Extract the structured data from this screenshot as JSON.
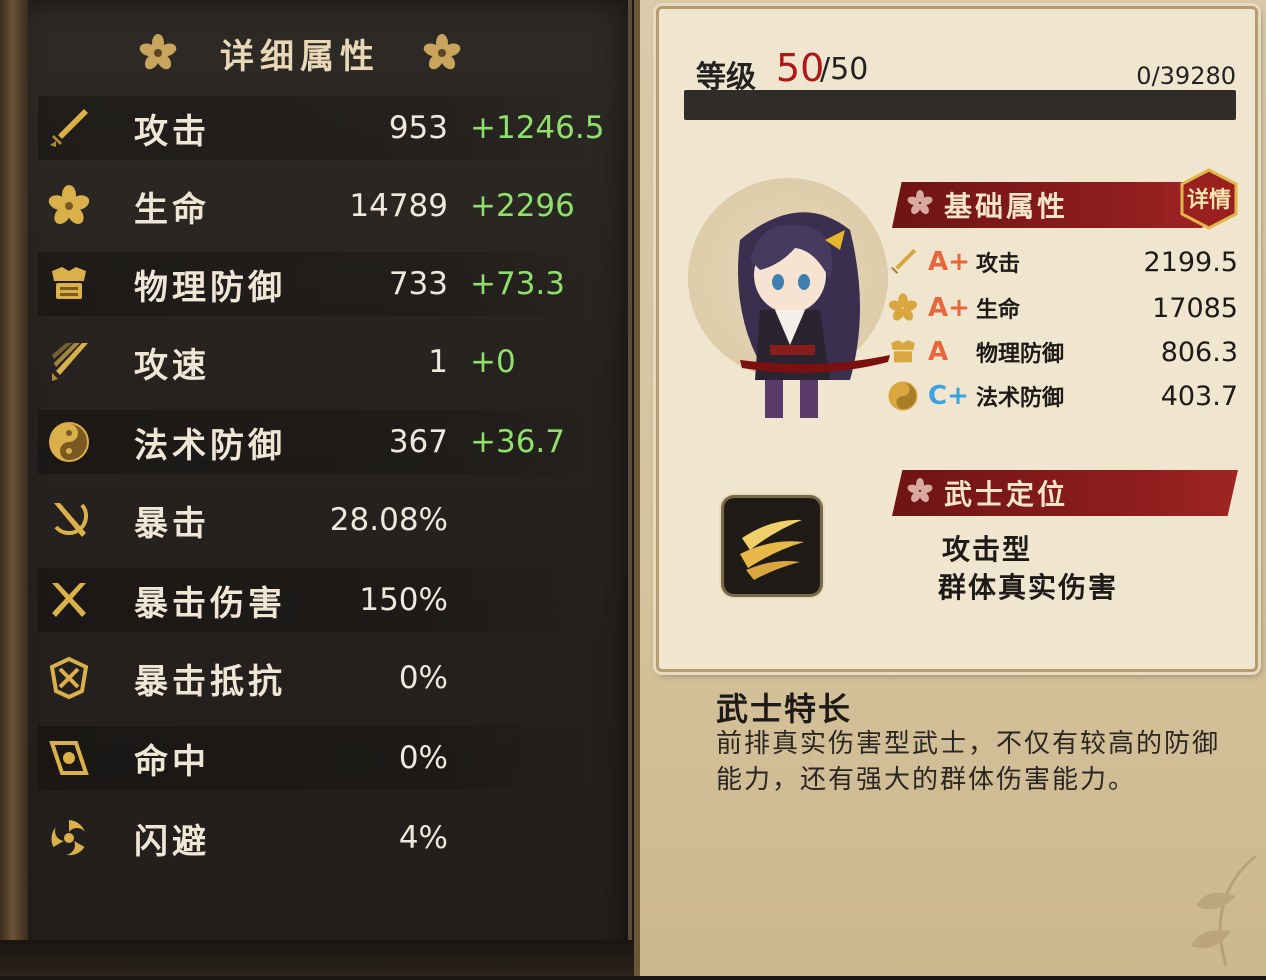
{
  "left_panel": {
    "title": "详细属性",
    "stats": [
      {
        "icon": "sword-icon",
        "name": "攻击",
        "base": "953",
        "bonus": "+1246.5"
      },
      {
        "icon": "sakura-icon",
        "name": "生命",
        "base": "14789",
        "bonus": "+2296"
      },
      {
        "icon": "armor-icon",
        "name": "物理防御",
        "base": "733",
        "bonus": "+73.3"
      },
      {
        "icon": "attack-speed-icon",
        "name": "攻速",
        "base": "1",
        "bonus": "+0"
      },
      {
        "icon": "yin-yang-icon",
        "name": "法术防御",
        "base": "367",
        "bonus": "+36.7"
      },
      {
        "icon": "crit-icon",
        "name": "暴击",
        "base": "28.08%",
        "bonus": ""
      },
      {
        "icon": "crit-damage-icon",
        "name": "暴击伤害",
        "base": "150%",
        "bonus": ""
      },
      {
        "icon": "crit-resist-icon",
        "name": "暴击抵抗",
        "base": "0%",
        "bonus": ""
      },
      {
        "icon": "accuracy-icon",
        "name": "命中",
        "base": "0%",
        "bonus": ""
      },
      {
        "icon": "dodge-icon",
        "name": "闪避",
        "base": "4%",
        "bonus": ""
      }
    ]
  },
  "right_panel": {
    "level": {
      "label": "等级",
      "current": "50",
      "max": "/50",
      "exp": "0/39280",
      "exp_progress": 0
    },
    "base_attributes": {
      "title": "基础属性",
      "detail_button": "详情",
      "rows": [
        {
          "icon": "sword-icon",
          "grade": "A+",
          "grade_color": "#e8663a",
          "name": "攻击",
          "value": "2199.5"
        },
        {
          "icon": "sakura-icon",
          "grade": "A+",
          "grade_color": "#e8663a",
          "name": "生命",
          "value": "17085"
        },
        {
          "icon": "armor-icon",
          "grade": "A",
          "grade_color": "#e8663a",
          "name": "物理防御",
          "value": "806.3"
        },
        {
          "icon": "yin-yang-icon",
          "grade": "C+",
          "grade_color": "#3aa3e0",
          "name": "法术防御",
          "value": "403.7"
        }
      ]
    },
    "role": {
      "title": "武士定位",
      "icon": "slash-icon",
      "lines": [
        "攻击型",
        "群体真实伤害"
      ]
    },
    "specialty": {
      "title": "武士特长",
      "description": "前排真实伤害型武士，不仅有较高的防御能力，还有强大的群体伤害能力。"
    }
  },
  "colors": {
    "bonus_green": "#8fe06a",
    "level_red": "#b01818",
    "banner_red": "#8e1d1d",
    "gold": "#d8a640"
  }
}
